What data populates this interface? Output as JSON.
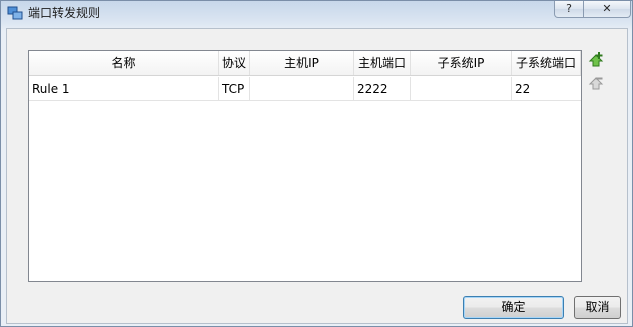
{
  "window": {
    "title": "端口转发规则",
    "help_glyph": "?",
    "close_glyph": "✕"
  },
  "table": {
    "columns": [
      "名称",
      "协议",
      "主机IP",
      "主机端口",
      "子系统IP",
      "子系统端口"
    ],
    "rows": [
      [
        "Rule 1",
        "TCP",
        "",
        "2222",
        "",
        "22"
      ]
    ]
  },
  "side_actions": {
    "add_icon": "add-rule-icon",
    "remove_icon": "remove-rule-icon"
  },
  "buttons": {
    "ok_label": "确定",
    "cancel_label": "取消"
  },
  "colors": {
    "accent": "#3c7fb1",
    "add_green": "#3a9a2a"
  }
}
